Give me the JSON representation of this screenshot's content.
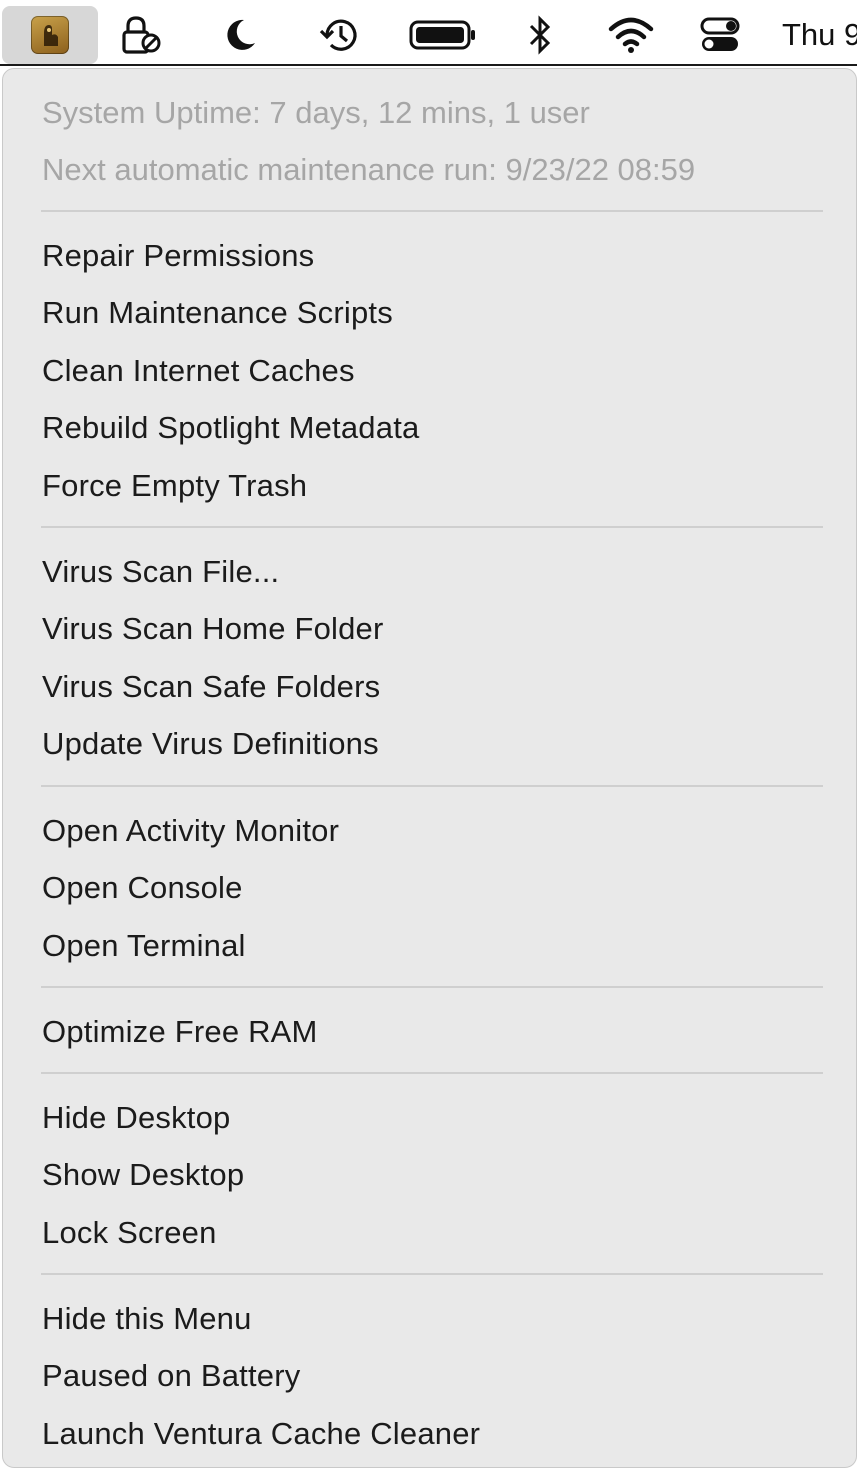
{
  "menubar": {
    "clock_text": "Thu 9",
    "status_icons": [
      "app-icon",
      "lock-user-icon",
      "moon-icon",
      "time-machine-icon",
      "battery-icon",
      "bluetooth-icon",
      "wifi-icon",
      "control-center-icon"
    ]
  },
  "menu": {
    "uptime": "System Uptime: 7 days, 12 mins, 1 user",
    "next_run": "Next automatic maintenance run:  9/23/22  08:59",
    "groups": [
      [
        "Repair Permissions",
        "Run Maintenance Scripts",
        "Clean Internet Caches",
        "Rebuild Spotlight Metadata",
        "Force Empty Trash"
      ],
      [
        "Virus Scan File...",
        "Virus Scan Home Folder",
        "Virus Scan Safe Folders",
        "Update Virus Definitions"
      ],
      [
        "Open Activity Monitor",
        "Open Console",
        "Open Terminal"
      ],
      [
        "Optimize Free RAM"
      ],
      [
        "Hide Desktop",
        "Show Desktop",
        "Lock Screen"
      ],
      [
        "Hide this Menu",
        "Paused on Battery",
        "Launch Ventura Cache Cleaner"
      ]
    ]
  }
}
